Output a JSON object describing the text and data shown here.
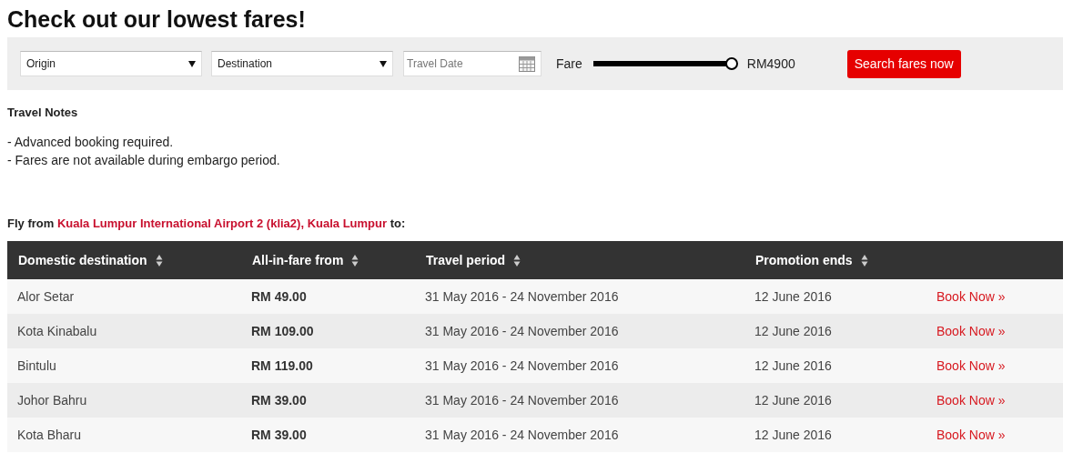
{
  "title": "Check out our lowest fares!",
  "filters": {
    "origin": {
      "placeholder": "Origin"
    },
    "destination": {
      "placeholder": "Destination"
    },
    "travel_date": {
      "placeholder": "Travel Date"
    },
    "fare_label": "Fare",
    "fare_slider": {
      "level": 1.0
    },
    "fare_reading": "RM4900",
    "search_button": "Search fares now"
  },
  "travel_notes": {
    "heading": "Travel Notes",
    "notes": [
      "- Advanced booking required.",
      "- Fares are not available during embargo period."
    ]
  },
  "route": {
    "prefix": "Fly from",
    "airport": "Kuala Lumpur International Airport 2 (klia2), Kuala Lumpur",
    "suffix": "to:"
  },
  "table": {
    "columns": [
      "Domestic destination",
      "All-in-fare from",
      "Travel period",
      "Promotion ends"
    ],
    "rows": [
      {
        "destination": "Alor Setar",
        "fare": "RM 49.00",
        "period": "31 May 2016 - 24 November 2016",
        "ends": "12 June 2016",
        "action": "Book Now »"
      },
      {
        "destination": "Kota Kinabalu",
        "fare": "RM 109.00",
        "period": "31 May 2016 - 24 November 2016",
        "ends": "12 June 2016",
        "action": "Book Now »"
      },
      {
        "destination": "Bintulu",
        "fare": "RM 119.00",
        "period": "31 May 2016 - 24 November 2016",
        "ends": "12 June 2016",
        "action": "Book Now »"
      },
      {
        "destination": "Johor Bahru",
        "fare": "RM 39.00",
        "period": "31 May 2016 - 24 November 2016",
        "ends": "12 June 2016",
        "action": "Book Now »"
      },
      {
        "destination": "Kota Bharu",
        "fare": "RM 39.00",
        "period": "31 May 2016 - 24 November 2016",
        "ends": "12 June 2016",
        "action": "Book Now »"
      }
    ]
  }
}
